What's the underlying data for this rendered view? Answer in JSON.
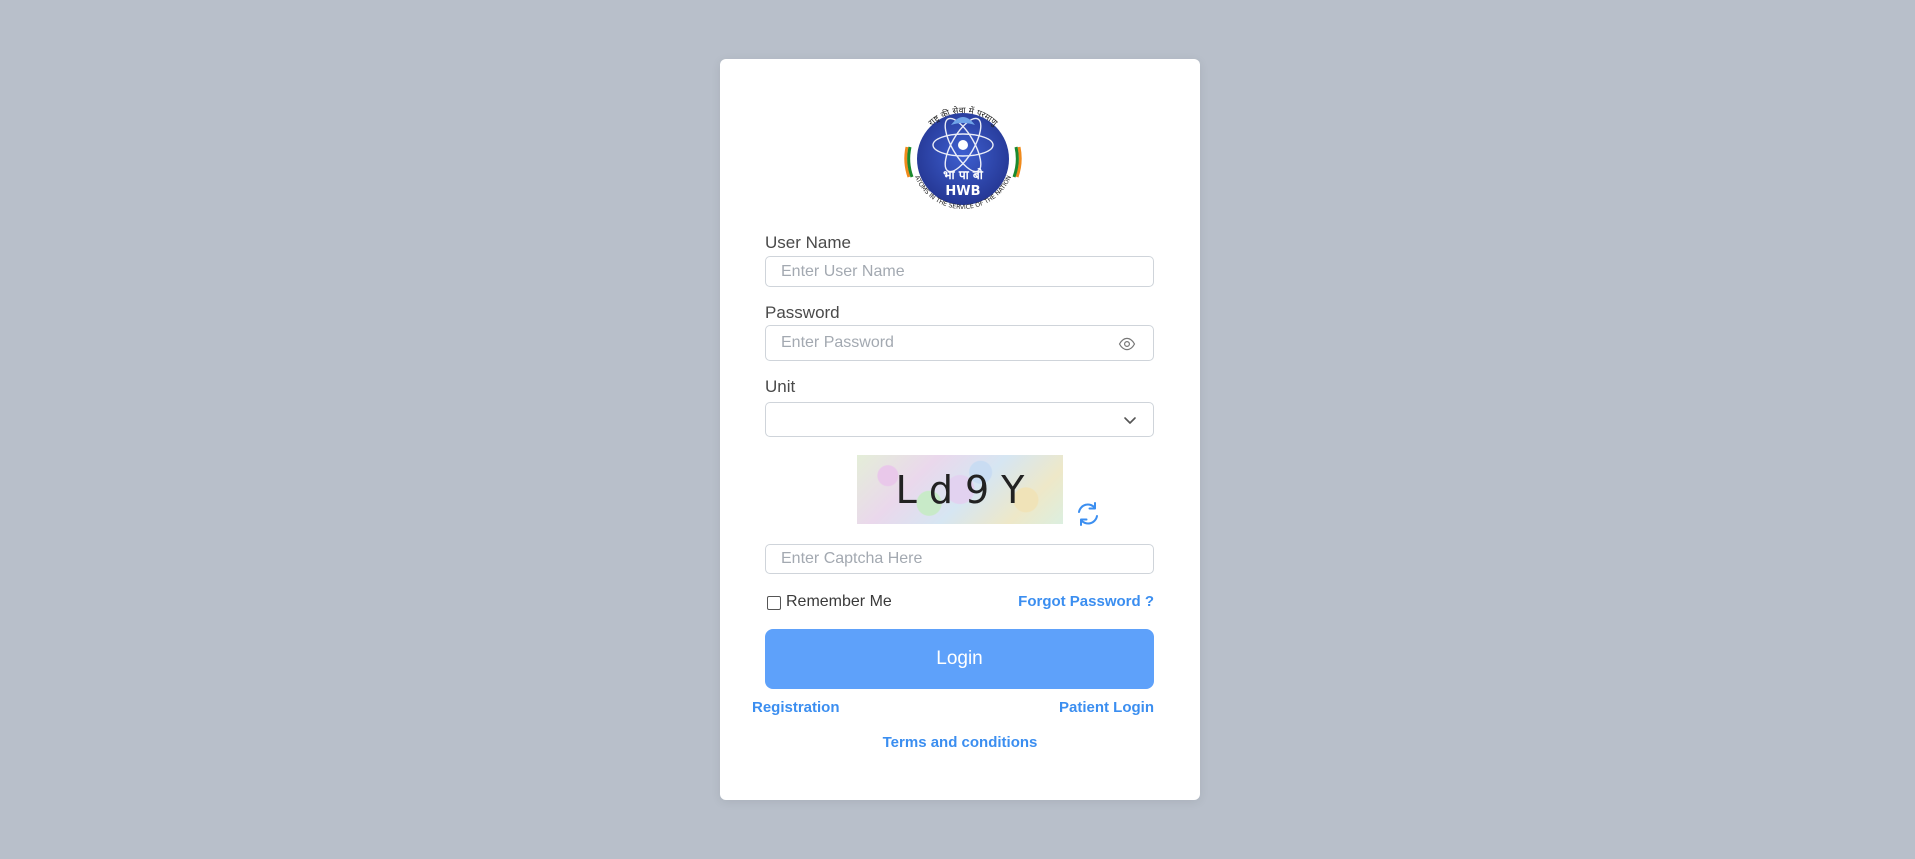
{
  "logo": {
    "hindi_arc_text": "राष्ट्र की सेवा में परमाणु",
    "english_arc_text": "ATOMS IN THE SERVICE OF THE NATION",
    "center_hindi": "भा पा बो",
    "center_abbr": "HWB"
  },
  "form": {
    "username": {
      "label": "User Name",
      "placeholder": "Enter User Name",
      "value": ""
    },
    "password": {
      "label": "Password",
      "placeholder": "Enter Password",
      "value": ""
    },
    "unit": {
      "label": "Unit",
      "selected": ""
    },
    "captcha": {
      "text": "Ld9Y",
      "placeholder": "Enter Captcha Here",
      "value": ""
    },
    "remember_label": "Remember Me",
    "forgot_label": "Forgot Password ?",
    "login_label": "Login"
  },
  "links": {
    "registration": "Registration",
    "patient_login": "Patient Login",
    "terms": "Terms and conditions"
  },
  "colors": {
    "background": "#b8bfca",
    "primary_button": "#5ea1fa",
    "link": "#3b8ef0",
    "logo_blue": "#2b3fa0"
  }
}
